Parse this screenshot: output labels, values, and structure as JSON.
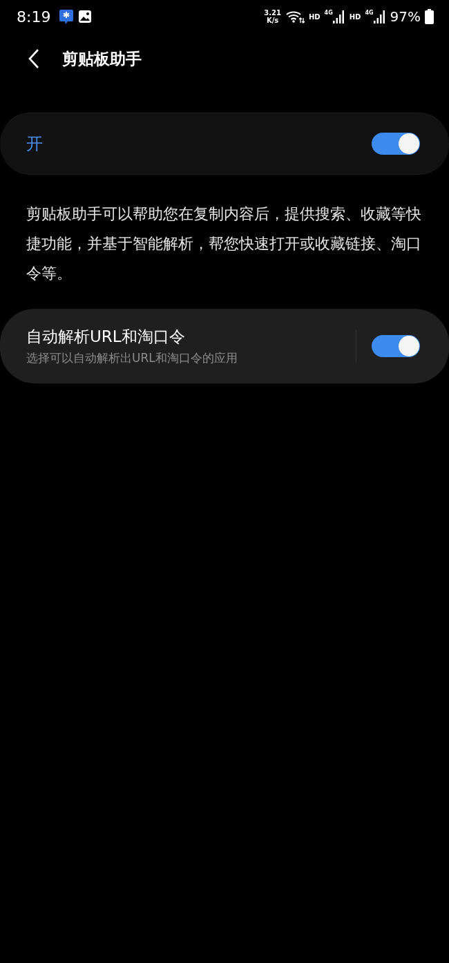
{
  "status_bar": {
    "time": "8:19",
    "speed_value": "3.21",
    "speed_unit": "K/s",
    "network": [
      {
        "hd": "HD",
        "gen": "4G"
      },
      {
        "hd": "HD",
        "gen": "4G"
      }
    ],
    "battery": "97%"
  },
  "header": {
    "title": "剪贴板助手"
  },
  "master_switch": {
    "label": "开",
    "on": true
  },
  "description": "剪贴板助手可以帮助您在复制内容后，提供搜索、收藏等快捷功能，并基于智能解析，帮您快速打开或收藏链接、淘口令等。",
  "settings": [
    {
      "title": "自动解析URL和淘口令",
      "subtitle": "选择可以自动解析出URL和淘口令的应用",
      "on": true
    }
  ]
}
